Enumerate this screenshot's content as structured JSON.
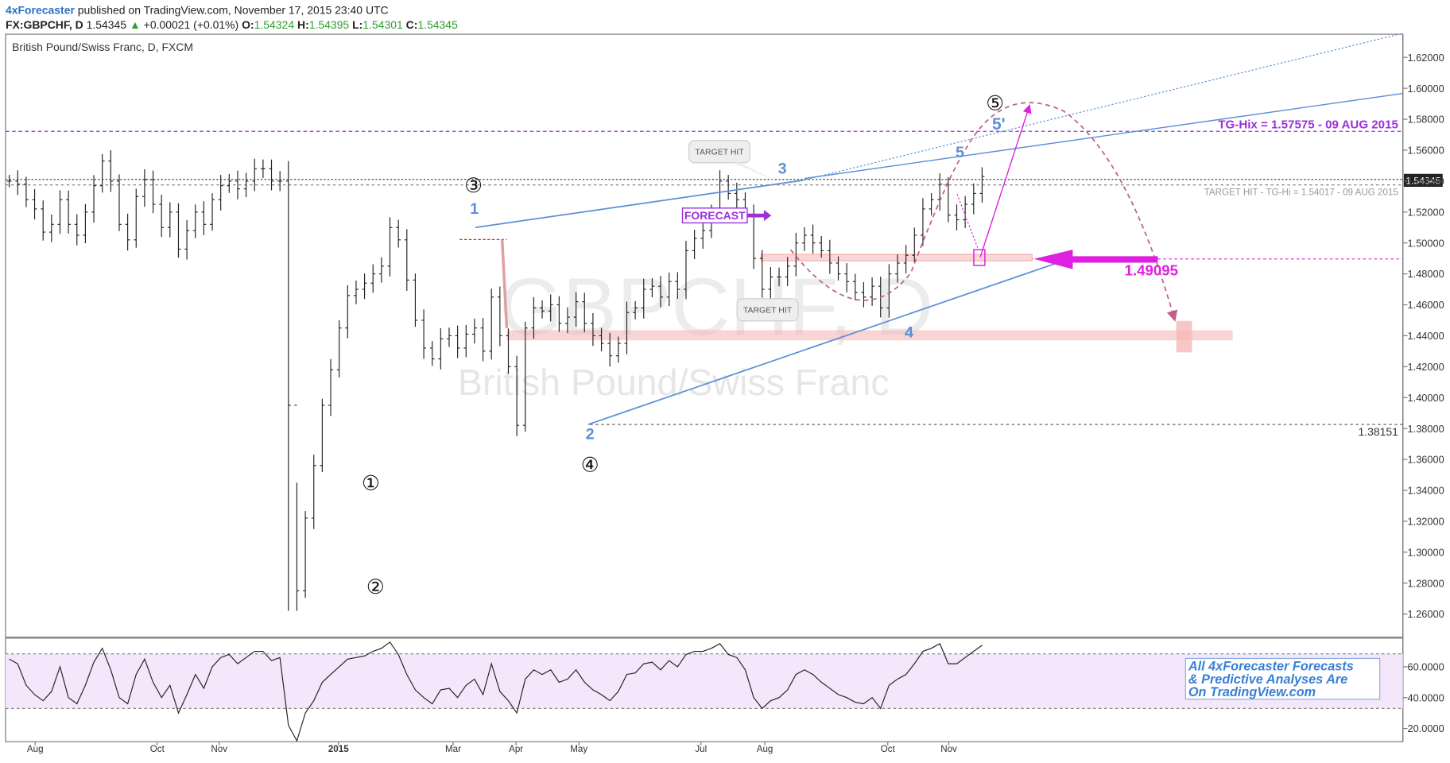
{
  "header": {
    "author": "4xForecaster",
    "published": "published on TradingView.com, November 17, 2015 23:40 UTC",
    "symbol": "FX:GBPCHF, D",
    "last": "1.54345",
    "change_arrow": "▲",
    "change": "+0.00021 (+0.01%)",
    "o_label": "O:",
    "o": "1.54324",
    "h_label": "H:",
    "h": "1.54395",
    "l_label": "L:",
    "l": "1.54301",
    "c_label": "C:",
    "c": "1.54345"
  },
  "chart_title": "British Pound/Swiss Franc, D, FXCM",
  "watermark": {
    "symbol": "GBPCHF, D",
    "name": "British Pound/Swiss Franc"
  },
  "price_badge": "1.54345",
  "annotations": {
    "tg_hix": "TG-Hix = 1.57575 - 09 AUG 2015",
    "target_hit_line": "TARGET HIT - TG-Hi = 1.54017 - 09 AUG 2015",
    "target_level": "1.49095",
    "low_level": "1.38151",
    "forecast": "FORECAST",
    "target_hit_1": "TARGET HIT",
    "target_hit_2": "TARGET HIT",
    "promo_line1": "All 4xForecaster Forecasts",
    "promo_line2": "& Predictive Analyses Are",
    "promo_line3": "On TradingView.com"
  },
  "wave_labels_blue": [
    "1",
    "2",
    "3",
    "4",
    "5",
    "5'"
  ],
  "wave_labels_circled": [
    "①",
    "②",
    "③",
    "④",
    "⑤"
  ],
  "colors": {
    "up": "#2e9e2e",
    "brand": "#2f6fbf",
    "wave_blue": "#5b8fd6",
    "magenta": "#e020e0",
    "purple": "#9b30d9",
    "dashed_pink": "#c0608a",
    "zone": "#f5b8b8"
  },
  "chart_data": {
    "type": "bar",
    "subtype": "ohlc",
    "symbol": "GBPCHF",
    "timeframe": "D",
    "price_axis": {
      "ticks": [
        "1.62000",
        "1.60000",
        "1.58000",
        "1.56000",
        "1.54000",
        "1.52000",
        "1.50000",
        "1.48000",
        "1.46000",
        "1.44000",
        "1.42000",
        "1.40000",
        "1.38000",
        "1.36000",
        "1.34000",
        "1.32000",
        "1.30000",
        "1.28000",
        "1.26000"
      ],
      "ylim": [
        1.245,
        1.635
      ]
    },
    "time_axis": {
      "ticks": [
        "Aug",
        "Oct",
        "Nov",
        "2015",
        "Mar",
        "Apr",
        "May",
        "Jul",
        "Aug",
        "Oct",
        "Nov"
      ]
    },
    "rsi": {
      "ticks": [
        "60.0000",
        "40.0000",
        "20.0000"
      ],
      "ylim": [
        12,
        78
      ],
      "bands": [
        70,
        30
      ]
    },
    "levels": [
      {
        "label": "TG-Hix",
        "value": 1.57575
      },
      {
        "label": "TG-Hi",
        "value": 1.54017
      },
      {
        "label": "last",
        "value": 1.54345
      },
      {
        "label": "target",
        "value": 1.49095
      },
      {
        "label": "low",
        "value": 1.38151
      }
    ],
    "price_series_close": [
      1.54,
      1.538,
      1.528,
      1.522,
      1.507,
      1.512,
      1.528,
      1.512,
      1.505,
      1.52,
      1.537,
      1.553,
      1.54,
      1.512,
      1.502,
      1.53,
      1.541,
      1.525,
      1.51,
      1.52,
      1.496,
      1.508,
      1.52,
      1.512,
      1.528,
      1.537,
      1.54,
      1.535,
      1.54,
      1.548,
      1.548,
      1.54,
      1.54,
      1.395,
      1.275,
      1.322,
      1.356,
      1.395,
      1.418,
      1.445,
      1.466,
      1.47,
      1.474,
      1.48,
      1.485,
      1.51,
      1.502,
      1.476,
      1.45,
      1.432,
      1.425,
      1.438,
      1.44,
      1.432,
      1.441,
      1.445,
      1.43,
      1.465,
      1.44,
      1.42,
      1.382,
      1.445,
      1.458,
      1.456,
      1.46,
      1.448,
      1.452,
      1.462,
      1.448,
      1.44,
      1.435,
      1.427,
      1.435,
      1.455,
      1.458,
      1.47,
      1.472,
      1.465,
      1.475,
      1.47,
      1.495,
      1.503,
      1.508,
      1.52,
      1.54,
      1.532,
      1.528,
      1.518,
      1.49,
      1.47,
      1.478,
      1.478,
      1.485,
      1.5,
      1.505,
      1.5,
      1.495,
      1.487,
      1.48,
      1.475,
      1.468,
      1.465,
      1.472,
      1.458,
      1.48,
      1.487,
      1.492,
      1.505,
      1.522,
      1.528,
      1.538,
      1.518,
      1.515,
      1.525,
      1.532,
      1.543
    ],
    "rsi_series": [
      65,
      62,
      48,
      42,
      38,
      44,
      60,
      40,
      36,
      48,
      63,
      72,
      58,
      40,
      36,
      55,
      65,
      50,
      40,
      48,
      30,
      42,
      55,
      46,
      60,
      66,
      68,
      62,
      66,
      70,
      70,
      64,
      66,
      22,
      12,
      30,
      38,
      50,
      55,
      60,
      65,
      66,
      67,
      70,
      72,
      76,
      68,
      55,
      45,
      40,
      36,
      45,
      46,
      40,
      48,
      52,
      42,
      62,
      44,
      38,
      30,
      52,
      58,
      55,
      58,
      50,
      52,
      58,
      50,
      45,
      42,
      38,
      44,
      55,
      56,
      62,
      63,
      58,
      64,
      60,
      68,
      70,
      70,
      72,
      75,
      68,
      66,
      58,
      40,
      33,
      38,
      40,
      45,
      55,
      58,
      55,
      50,
      46,
      42,
      40,
      37,
      36,
      40,
      33,
      48,
      52,
      55,
      62,
      70,
      72,
      75,
      62,
      62,
      66,
      70,
      74
    ]
  }
}
